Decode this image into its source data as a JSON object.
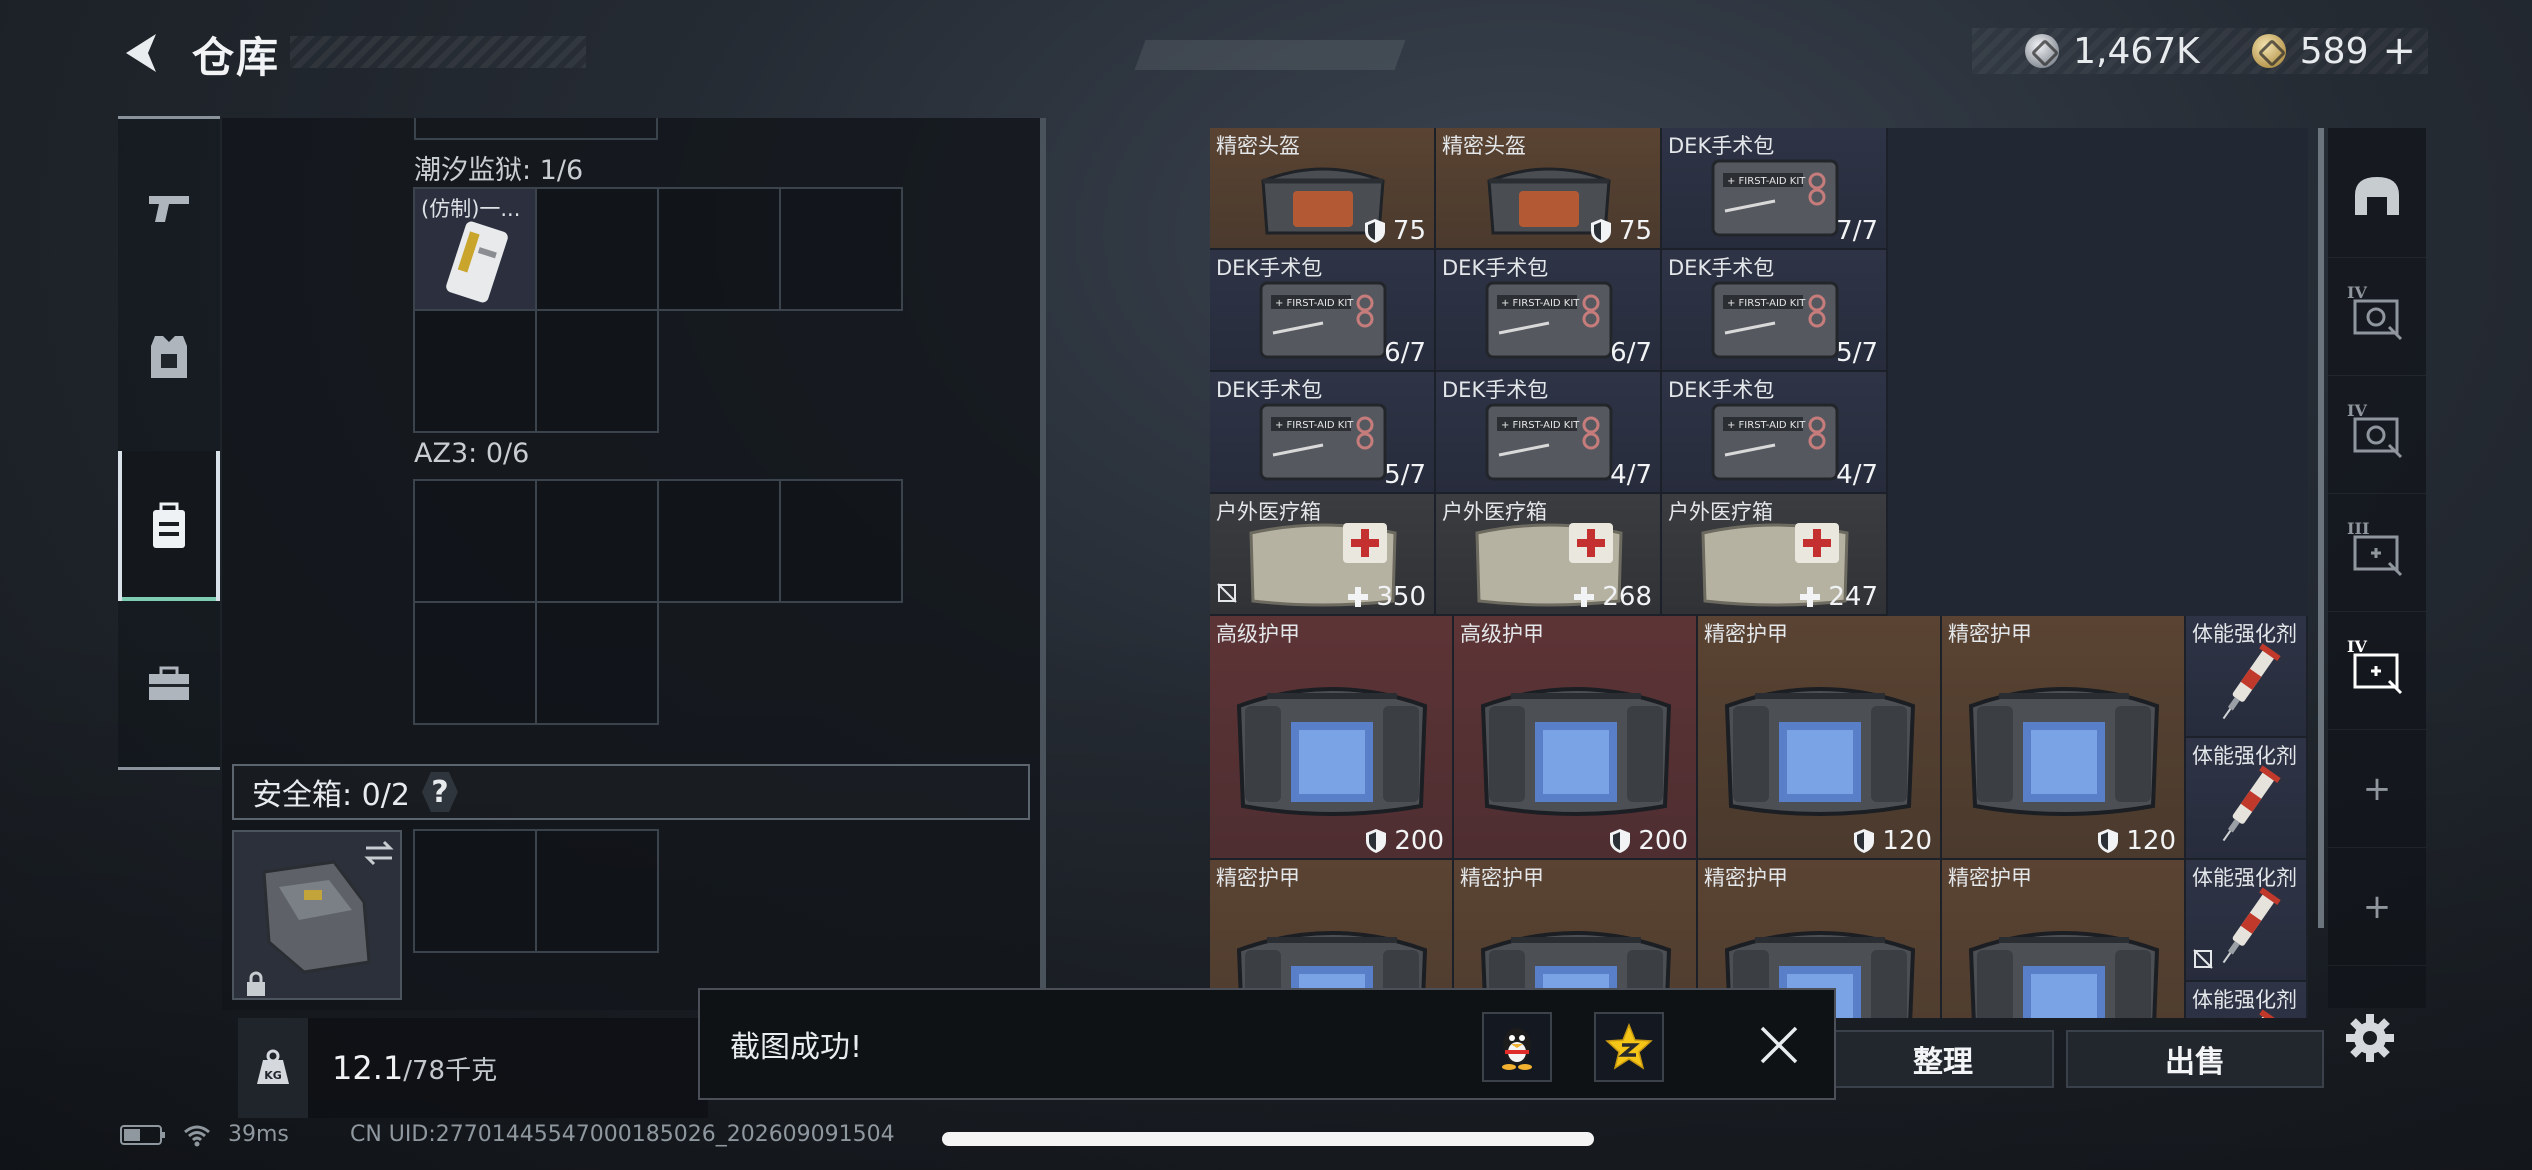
{
  "header": {
    "title": "仓库",
    "currency": {
      "silver": "1,467K",
      "gold": "589",
      "gold_add": "+"
    }
  },
  "sidebar": {
    "items": [
      {
        "icon": "pistol-icon"
      },
      {
        "icon": "armor-vest-icon"
      },
      {
        "icon": "backpack-icon",
        "active": true
      },
      {
        "icon": "toolbox-icon"
      }
    ]
  },
  "backpack": {
    "section1_label": "潮汐监狱: 1/6",
    "section1_item_label": "(仿制)一...",
    "section2_label": "AZ3: 0/6",
    "safe_box_label": "安全箱: 0/2",
    "help": "?"
  },
  "weight": {
    "current": "12.1",
    "max": "/78千克",
    "icon_text": "KG"
  },
  "status": {
    "ping": "39ms",
    "uid": "CN UID:27701445547000185026_202609091504"
  },
  "warehouse": {
    "items": [
      {
        "name": "精密头盔",
        "value": "75",
        "type": "shield"
      },
      {
        "name": "精密头盔",
        "value": "75",
        "type": "shield"
      },
      {
        "name": "DEK手术包",
        "value": "7/7",
        "type": "count"
      },
      {
        "name": "DEK手术包",
        "value": "6/7",
        "type": "count"
      },
      {
        "name": "DEK手术包",
        "value": "6/7",
        "type": "count"
      },
      {
        "name": "DEK手术包",
        "value": "5/7",
        "type": "count"
      },
      {
        "name": "DEK手术包",
        "value": "5/7",
        "type": "count"
      },
      {
        "name": "DEK手术包",
        "value": "4/7",
        "type": "count"
      },
      {
        "name": "DEK手术包",
        "value": "4/7",
        "type": "count"
      },
      {
        "name": "户外医疗箱",
        "value": "350",
        "type": "heal"
      },
      {
        "name": "户外医疗箱",
        "value": "268",
        "type": "heal"
      },
      {
        "name": "户外医疗箱",
        "value": "247",
        "type": "heal"
      },
      {
        "name": "高级护甲",
        "value": "200",
        "type": "shield"
      },
      {
        "name": "高级护甲",
        "value": "200",
        "type": "shield"
      },
      {
        "name": "精密护甲",
        "value": "120",
        "type": "shield"
      },
      {
        "name": "精密护甲",
        "value": "120",
        "type": "shield"
      },
      {
        "name": "体能强化剂",
        "value": "",
        "type": "none"
      },
      {
        "name": "体能强化剂",
        "value": "",
        "type": "none"
      },
      {
        "name": "精密护甲",
        "value": "",
        "type": "none"
      },
      {
        "name": "精密护甲",
        "value": "",
        "type": "none"
      },
      {
        "name": "精密护甲",
        "value": "",
        "type": "none"
      },
      {
        "name": "精密护甲",
        "value": "",
        "type": "none"
      },
      {
        "name": "体能强化剂",
        "value": "",
        "type": "none"
      },
      {
        "name": "体能强化剂",
        "value": "",
        "type": "none"
      }
    ]
  },
  "filters": {
    "items": [
      {
        "icon": "helmet-filter-icon"
      },
      {
        "icon": "tier4-gear-filter-icon",
        "tier": "IV"
      },
      {
        "icon": "tier4-gear-filter-icon",
        "tier": "IV"
      },
      {
        "icon": "tier3-medkit-filter-icon",
        "tier": "III"
      },
      {
        "icon": "tier4-medkit-filter-icon",
        "tier": "IV"
      },
      {
        "icon": "add-filter-icon",
        "label": "+"
      },
      {
        "icon": "add-filter-icon",
        "label": "+"
      }
    ]
  },
  "buttons": {
    "sort": "整理",
    "sell": "出售"
  },
  "toast": {
    "message": "截图成功!"
  },
  "colors": {
    "accent": "#7ecdb2",
    "panel": "#12161b",
    "gold_item": "#5a4332",
    "red_item": "#5d3436",
    "blue_item": "#2e3446"
  }
}
